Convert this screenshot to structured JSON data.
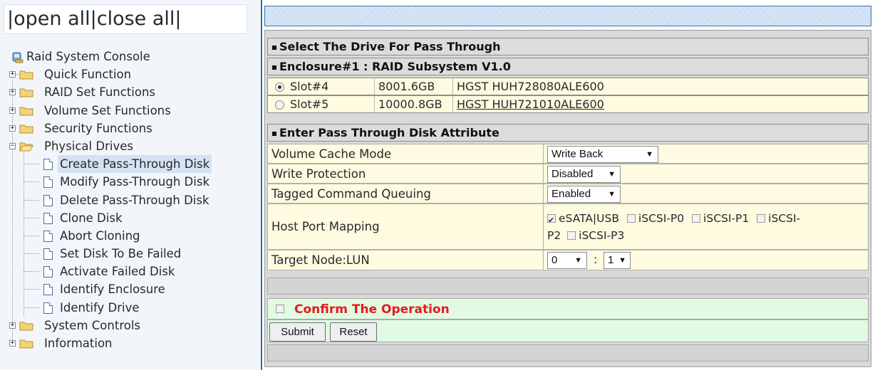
{
  "nav": {
    "open_all": "open all",
    "close_all": "close all",
    "pipe": "|"
  },
  "tree": {
    "root": "Raid System Console",
    "quick_function": "Quick Function",
    "raid_set_functions": "RAID Set Functions",
    "volume_set_functions": "Volume Set Functions",
    "security_functions": "Security Functions",
    "physical_drives": "Physical Drives",
    "physical_children": [
      "Create Pass-Through Disk",
      "Modify Pass-Through Disk",
      "Delete Pass-Through Disk",
      "Clone Disk",
      "Abort Cloning",
      "Set Disk To Be Failed",
      "Activate Failed Disk",
      "Identify Enclosure",
      "Identify Drive"
    ],
    "system_controls": "System Controls",
    "information": "Information"
  },
  "drive_select": {
    "title": "Select The Drive For Pass Through",
    "enclosure": "Enclosure#1 : RAID Subsystem V1.0",
    "drives": [
      {
        "slot": "Slot#4",
        "capacity": "8001.6GB",
        "model": "HGST HUH728080ALE600",
        "selected": true
      },
      {
        "slot": "Slot#5",
        "capacity": "10000.8GB",
        "model": "HGST HUH721010ALE600",
        "selected": false
      }
    ]
  },
  "attributes": {
    "title": "Enter Pass Through Disk Attribute",
    "volume_cache_mode": {
      "label": "Volume Cache Mode",
      "value": "Write Back"
    },
    "write_protection": {
      "label": "Write Protection",
      "value": "Disabled"
    },
    "tagged_command_queuing": {
      "label": "Tagged Command Queuing",
      "value": "Enabled"
    },
    "host_port_mapping": {
      "label": "Host Port Mapping",
      "ports": [
        "eSATA|USB",
        "iSCSI-P0",
        "iSCSI-P1",
        "iSCSI-",
        "P2",
        "iSCSI-P3"
      ]
    },
    "target_node_lun": {
      "label": "Target Node:LUN",
      "node": "0",
      "separator": ":",
      "lun": "1"
    }
  },
  "confirm": {
    "label": "Confirm The Operation",
    "checked": false
  },
  "buttons": {
    "submit": "Submit",
    "reset": "Reset"
  },
  "colors": {
    "accent_blue": "#3b6ea5",
    "row_yellow": "#fffbe0",
    "confirm_green": "#e1fbe3",
    "confirm_red": "#e8191a"
  },
  "icons": [
    "console-icon",
    "expander-plus-icon",
    "expander-minus-icon",
    "folder-icon",
    "folder-open-icon",
    "page-icon",
    "radio-icon",
    "checkbox-icon",
    "dropdown-arrow-icon"
  ]
}
